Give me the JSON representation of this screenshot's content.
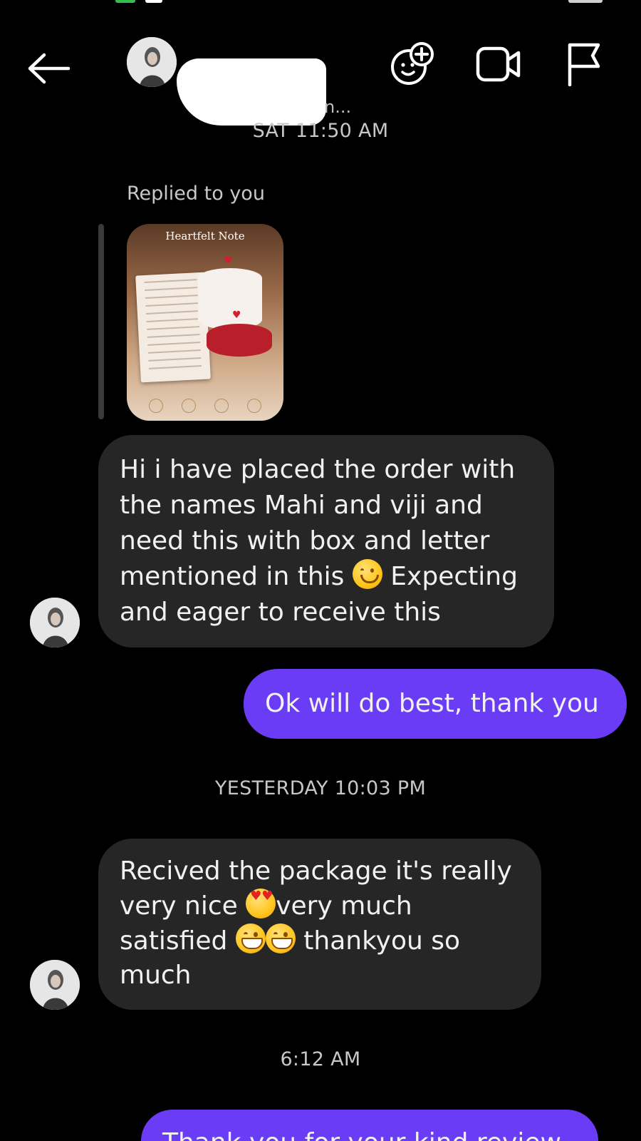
{
  "header": {
    "contact_name_suffix": "n...",
    "icons": {
      "back": "arrow-left-icon",
      "effects": "face-plus-icon",
      "video": "video-camera-icon",
      "report": "flag-icon"
    }
  },
  "conversation": {
    "timestamps": [
      "SAT 11:50 AM",
      "YESTERDAY 10:03 PM",
      "6:12 AM"
    ],
    "reply_label": "Replied to you",
    "story_preview_title": "Heartfelt Note",
    "messages": [
      {
        "direction": "incoming",
        "lines": [
          "Hi i have placed the order with",
          "the names Mahi and viji and",
          "need this with box and letter",
          "mentioned in this",
          "Expecting",
          "and eager to receive this"
        ]
      },
      {
        "direction": "outgoing",
        "text": "Ok will do best, thank you"
      },
      {
        "direction": "incoming",
        "lines": [
          "Recived the package it's really",
          "very nice",
          "very much",
          "satisfied",
          "thankyou so",
          "much"
        ]
      },
      {
        "direction": "outgoing",
        "text": "Thank you for your kind review"
      }
    ]
  },
  "colors": {
    "background": "#000000",
    "incoming_bubble": "#262626",
    "outgoing_bubble": "#6a3cf5",
    "timestamp_text": "#c7c7c7"
  }
}
